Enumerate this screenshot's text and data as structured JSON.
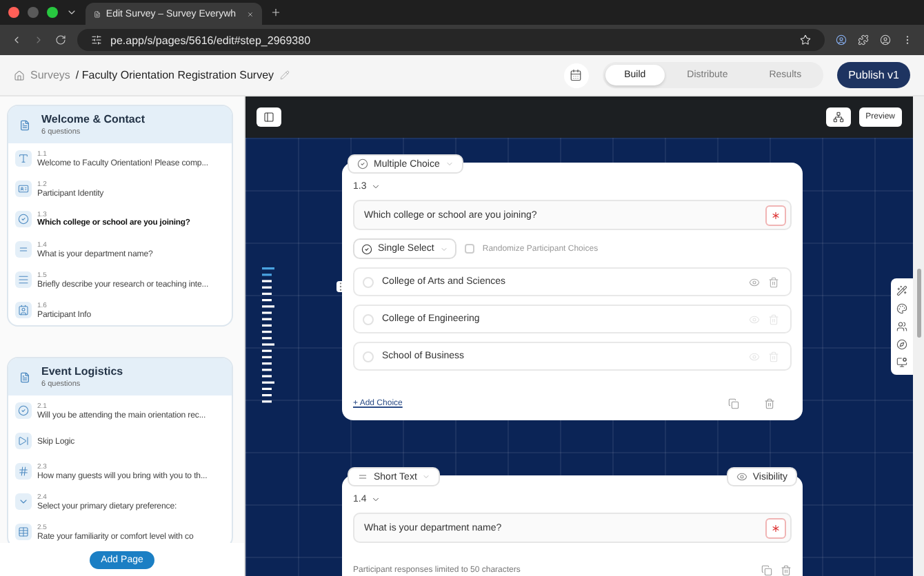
{
  "browser": {
    "tab_title": "Edit Survey – Survey Everywh",
    "url": "pe.app/s/pages/5616/edit#step_2969380"
  },
  "header": {
    "root": "Surveys",
    "title": "/ Faculty Orientation Registration Survey",
    "tabs": [
      {
        "label": "Build",
        "selected": true
      },
      {
        "label": "Distribute",
        "selected": false
      },
      {
        "label": "Results",
        "selected": false
      }
    ],
    "publish": "Publish v1"
  },
  "sidebar": {
    "sections": [
      {
        "title": "Welcome & Contact",
        "count": "6 questions",
        "items": [
          {
            "kind": "text",
            "number": "1.1",
            "text": "Welcome to Faculty Orientation! Please comp...",
            "selected": false
          },
          {
            "kind": "identity",
            "number": "1.2",
            "text": "Participant Identity",
            "selected": false
          },
          {
            "kind": "choice",
            "number": "1.3",
            "text": "Which college or school are you joining?",
            "selected": true
          },
          {
            "kind": "short",
            "number": "1.4",
            "text": "What is your department name?",
            "selected": false
          },
          {
            "kind": "long",
            "number": "1.5",
            "text": "Briefly describe your research or teaching inte...",
            "selected": false
          },
          {
            "kind": "info",
            "number": "1.6",
            "text": "Participant Info",
            "selected": false
          }
        ]
      },
      {
        "title": "Event Logistics",
        "count": "6 questions",
        "items": [
          {
            "kind": "choice",
            "number": "2.1",
            "text": "Will you be attending the main orientation rec...",
            "selected": false
          },
          {
            "kind": "logic",
            "text": "Skip Logic",
            "selected": false
          },
          {
            "kind": "number",
            "number": "2.3",
            "text": "How many guests will you bring with you to th...",
            "selected": false
          },
          {
            "kind": "dropdown",
            "number": "2.4",
            "text": "Select your primary dietary preference:",
            "selected": false
          },
          {
            "kind": "matrix",
            "number": "2.5",
            "text": "Rate your familiarity or comfort level with co",
            "selected": false
          }
        ]
      }
    ],
    "add_page": "Add Page"
  },
  "canvas": {
    "preview": "Preview",
    "questions": [
      {
        "kind": "choice",
        "type": "Multiple Choice",
        "number": "1.3",
        "text": "Which college or school are you joining?",
        "mode": "Single Select",
        "randomize": {
          "label": "Randomize Participant Choices",
          "checked": false
        },
        "choices": [
          "College of Arts and Sciences",
          "College of Engineering",
          "School of Business"
        ],
        "add_choice": "+ Add Choice"
      },
      {
        "kind": "short",
        "type": "Short Text",
        "visibility": "Visibility",
        "number": "1.4",
        "text": "What is your department name?",
        "note": "Participant responses limited to 50 characters"
      }
    ]
  }
}
